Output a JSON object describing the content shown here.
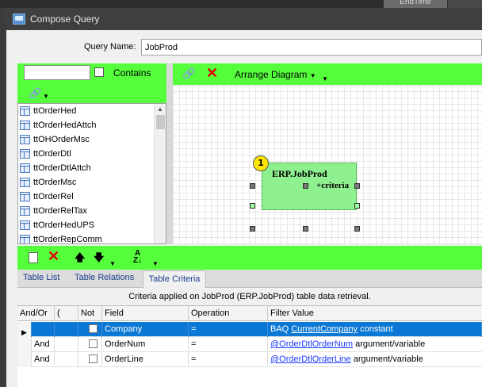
{
  "background_app": {
    "header_fragment": "EndTime"
  },
  "window": {
    "title": "Compose Query"
  },
  "query_name": {
    "label": "Query Name:",
    "value": "JobProd"
  },
  "table_search": {
    "value": "",
    "contains_label": "Contains",
    "contains_checked": false
  },
  "tables": [
    "ttOrderHed",
    "ttOrderHedAttch",
    "ttOHOrderMsc",
    "ttOrderDtl",
    "ttOrderDtlAttch",
    "ttOrderMsc",
    "ttOrderRel",
    "ttOrderRelTax",
    "ttOrderHedUPS",
    "ttOrderRepComm"
  ],
  "diagram": {
    "arrange_label": "Arrange Diagram",
    "nodes": [
      {
        "badge": "1",
        "name": "ERP.JobProd",
        "criteria": "+criteria"
      }
    ]
  },
  "tabs": {
    "items": [
      "Table List",
      "Table Relations",
      "Table Criteria"
    ],
    "active": "Table Criteria"
  },
  "criteria": {
    "description": "Criteria applied on JobProd (ERP.JobProd)  table data retrieval.",
    "columns": [
      "And/Or",
      "(",
      "Not",
      "Field",
      "Operation",
      "Filter Value"
    ],
    "rows": [
      {
        "andor": "",
        "paren": "",
        "not": false,
        "field": "Company",
        "operation": "=",
        "value_prefix": "BAQ ",
        "value_link": "CurrentCompany",
        "value_suffix": " constant",
        "selected": true
      },
      {
        "andor": "And",
        "paren": "",
        "not": false,
        "field": "OrderNum",
        "operation": "=",
        "value_prefix": "",
        "value_link": "@OrderDtlOrderNum",
        "value_suffix": " argument/variable",
        "selected": false
      },
      {
        "andor": "And",
        "paren": "",
        "not": false,
        "field": "OrderLine",
        "operation": "=",
        "value_prefix": "",
        "value_link": "@OrderDtlOrderLine",
        "value_suffix": " argument/variable",
        "selected": false
      }
    ]
  },
  "colors": {
    "toolbar_green": "#55ff3c",
    "node_green": "#8ef08e",
    "selection_blue": "#0a78d4",
    "delete_red": "#e00000"
  }
}
